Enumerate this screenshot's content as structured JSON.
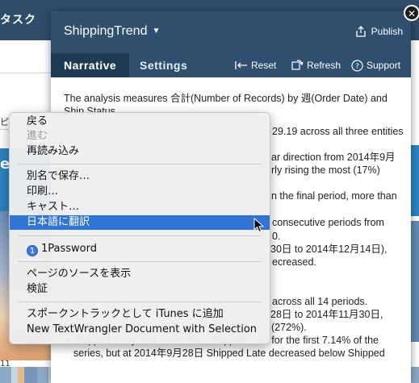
{
  "background": {
    "topbar_text": "タスク",
    "preview_text": "ピュー",
    "blue_label": "e",
    "left_number": "11"
  },
  "dialog": {
    "title": "ShippingTrend",
    "publish_label": "Publish",
    "tabs": [
      {
        "label": "Narrative"
      },
      {
        "label": "Settings"
      }
    ],
    "actions": {
      "reset": "Reset",
      "refresh": "Refresh",
      "support": "Support"
    },
    "body": {
      "para1_line1": "The analysis measures 合計(Number of Records) by 週(Order Date) and",
      "para1_line2": "Ship Status.",
      "line_a": "29.19 across all three entities",
      "line_b": "ar direction from 2014年9月",
      "line_c": "rly rising the most (17%)",
      "line_d": "n the final period, more than",
      "line_e": "consecutive periods from",
      "line_f": "0.",
      "line_g": "30日 to 2014年12月14日),",
      "line_h": "ecreased.",
      "line_i": "across all 14 periods.",
      "line_j": "28日 to 2014年11月30日,",
      "line_k": "(272%).",
      "bullet_1": "Shipped Early was lower than Shipped Late for the first 7.14% of the",
      "bullet_2": "series, but at 2014年9月28日 Shipped Late decreased below Shipped"
    }
  },
  "context_menu": {
    "items": [
      {
        "label": "戻る",
        "disabled": false
      },
      {
        "label": "進む",
        "disabled": true
      },
      {
        "label": "再読み込み",
        "disabled": false
      },
      {
        "label": "別名で保存…",
        "disabled": false
      },
      {
        "label": "印刷…",
        "disabled": false
      },
      {
        "label": "キャスト…",
        "disabled": false
      },
      {
        "label": "日本語に翻訳",
        "disabled": false,
        "highlighted": true
      },
      {
        "label": "1Password",
        "disabled": false
      },
      {
        "label": "ページのソースを表示",
        "disabled": false
      },
      {
        "label": "検証",
        "disabled": false
      },
      {
        "label": "スポークントラックとして iTunes に追加",
        "disabled": false
      },
      {
        "label": "New TextWrangler Document with Selection",
        "disabled": false
      }
    ]
  },
  "colors": {
    "header": "#2e4f6e",
    "tab_active": "#1f3a55",
    "menu_highlight": "#2f74d6"
  }
}
